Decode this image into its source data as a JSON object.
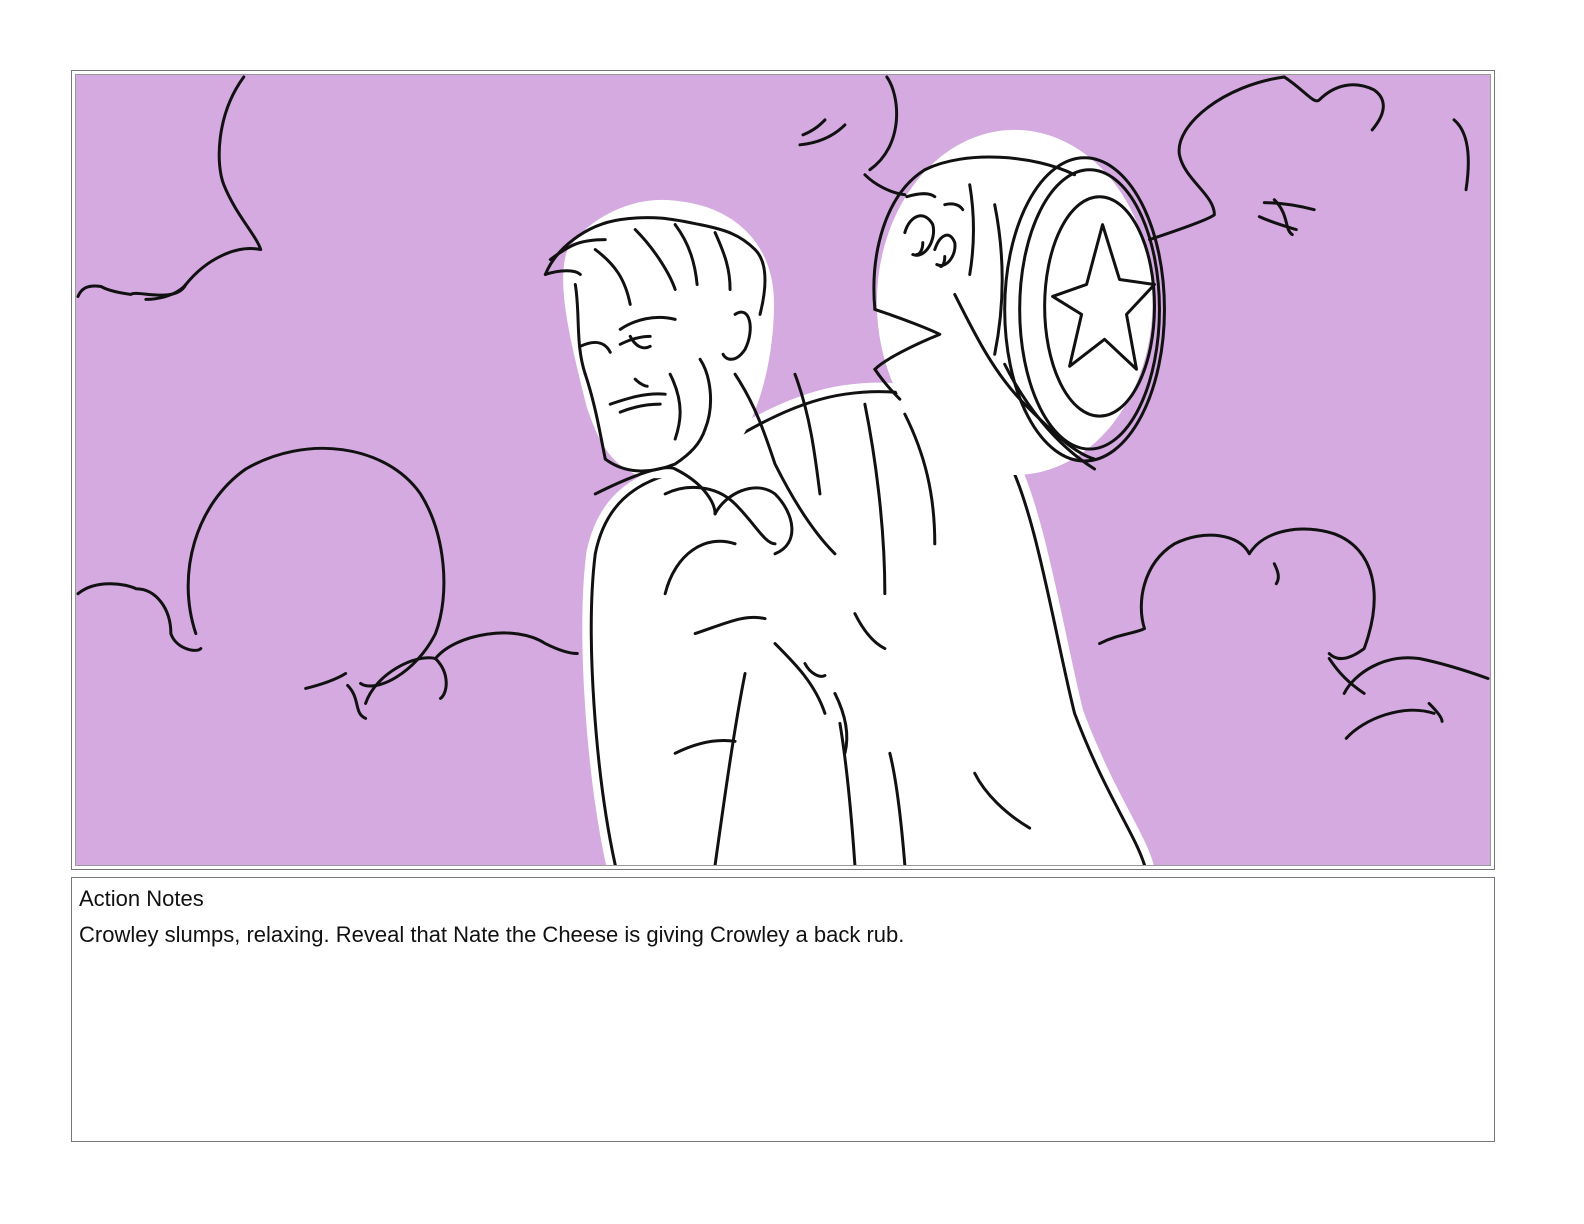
{
  "panel": {
    "background_color": "#d4aae0",
    "line_color": "#111111",
    "icons": [
      "clouds-sketch",
      "man-with-beard-sketch",
      "cheese-wheel-character-sketch"
    ]
  },
  "notes": {
    "heading": "Action Notes",
    "text": "Crowley slumps, relaxing.  Reveal that Nate the Cheese is giving Crowley a back rub."
  }
}
